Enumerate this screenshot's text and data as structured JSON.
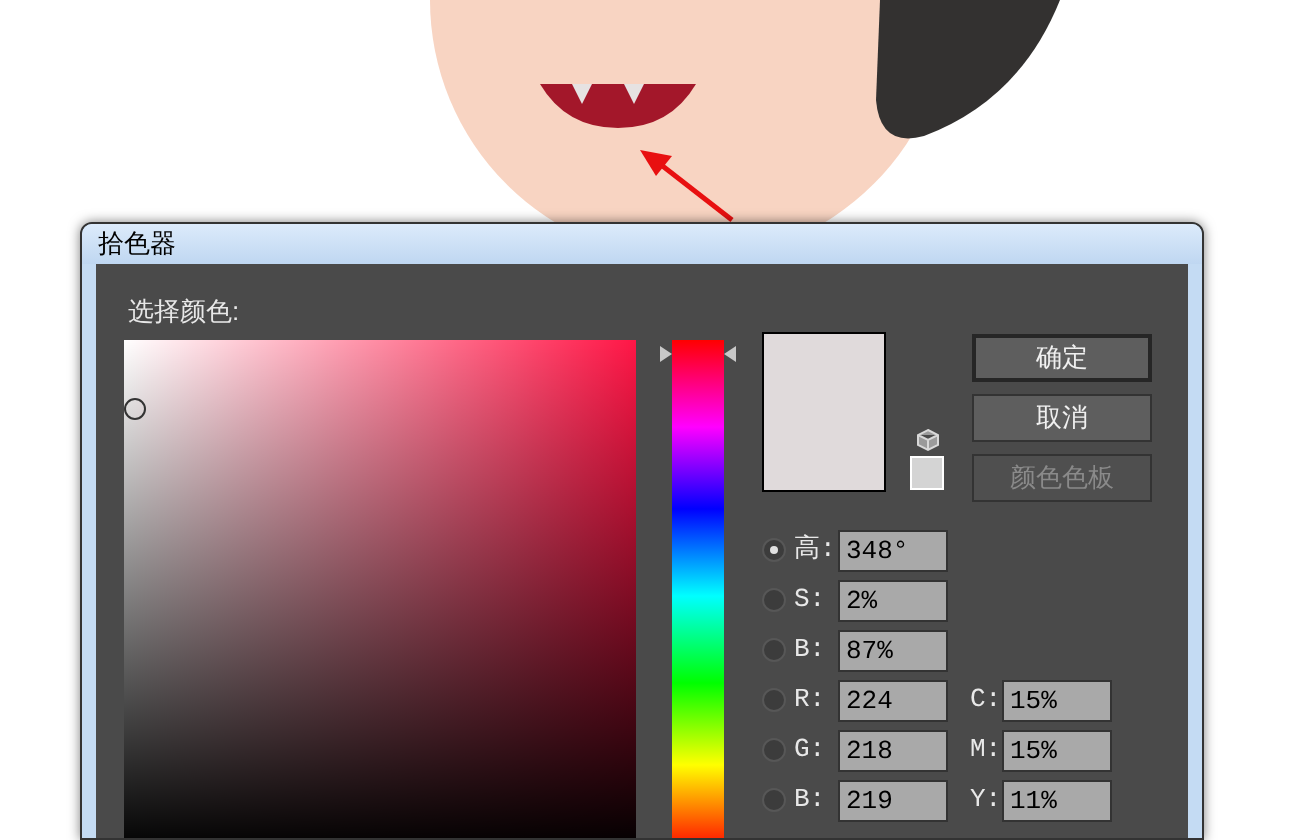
{
  "dialog": {
    "title": "拾色器",
    "prompt": "选择颜色:",
    "hue_slider": {
      "level": 0.97
    },
    "buttons": [
      {
        "label": "确定",
        "disabled": false,
        "default": true
      },
      {
        "label": "取消",
        "disabled": false,
        "default": false
      },
      {
        "label": "颜色色板",
        "disabled": true,
        "default": false
      }
    ],
    "model_fields": [
      {
        "label": "高:",
        "value": "348°",
        "selected": true
      },
      {
        "label": "S:",
        "value": "2%",
        "selected": false
      },
      {
        "label": "B:",
        "value": "87%",
        "selected": false
      },
      {
        "label": "R:",
        "value": "224",
        "selected": false
      },
      {
        "label": "G:",
        "value": "218",
        "selected": false
      },
      {
        "label": "B:",
        "value": "219",
        "selected": false
      }
    ],
    "cmyk_fields": [
      {
        "label": "C:",
        "value": "15%"
      },
      {
        "label": "M:",
        "value": "15%"
      },
      {
        "label": "Y:",
        "value": "11%"
      }
    ]
  }
}
